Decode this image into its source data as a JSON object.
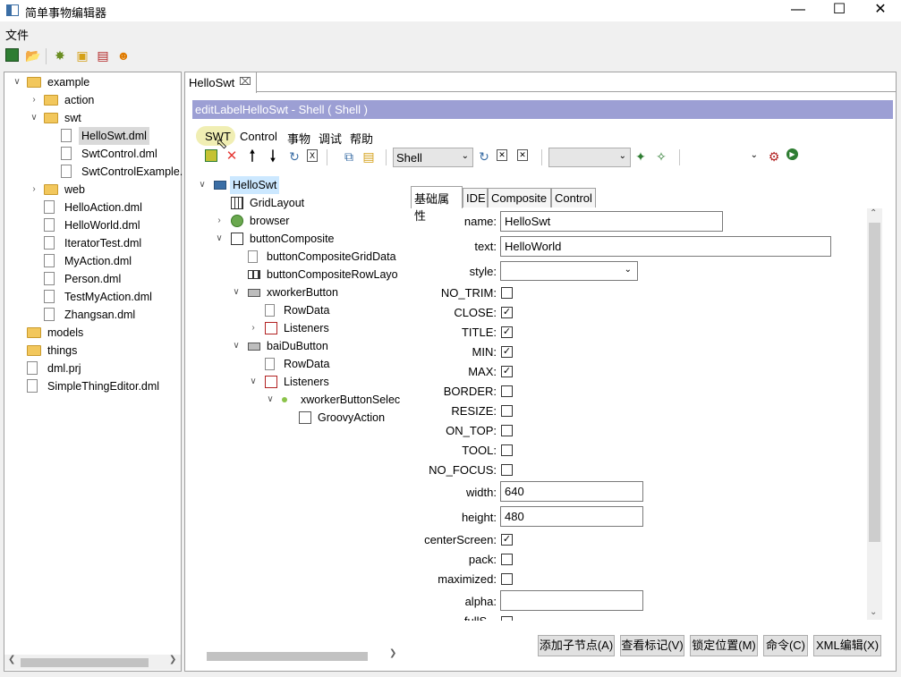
{
  "window": {
    "title": "简单事物编辑器"
  },
  "menu": {
    "file": "文件"
  },
  "tree": [
    {
      "label": "example",
      "depth": 0,
      "type": "folder",
      "expanded": true
    },
    {
      "label": "action",
      "depth": 1,
      "type": "folder",
      "expanded": false
    },
    {
      "label": "swt",
      "depth": 1,
      "type": "folder",
      "expanded": true
    },
    {
      "label": "HelloSwt.dml",
      "depth": 2,
      "type": "file",
      "selected": true
    },
    {
      "label": "SwtControl.dml",
      "depth": 2,
      "type": "file"
    },
    {
      "label": "SwtControlExample.",
      "depth": 2,
      "type": "file"
    },
    {
      "label": "web",
      "depth": 1,
      "type": "folder",
      "expanded": false
    },
    {
      "label": "HelloAction.dml",
      "depth": 1,
      "type": "file"
    },
    {
      "label": "HelloWorld.dml",
      "depth": 1,
      "type": "file"
    },
    {
      "label": "IteratorTest.dml",
      "depth": 1,
      "type": "file"
    },
    {
      "label": "MyAction.dml",
      "depth": 1,
      "type": "file"
    },
    {
      "label": "Person.dml",
      "depth": 1,
      "type": "file"
    },
    {
      "label": "TestMyAction.dml",
      "depth": 1,
      "type": "file"
    },
    {
      "label": "Zhangsan.dml",
      "depth": 1,
      "type": "file"
    },
    {
      "label": "models",
      "depth": 0,
      "type": "folder"
    },
    {
      "label": "things",
      "depth": 0,
      "type": "folder"
    },
    {
      "label": "dml.prj",
      "depth": 0,
      "type": "file"
    },
    {
      "label": "SimpleThingEditor.dml",
      "depth": 0,
      "type": "file"
    }
  ],
  "editor": {
    "tab_label": "HelloSwt",
    "header": "editLabelHelloSwt - Shell ( Shell )",
    "submenu": [
      "SWT",
      "Control",
      "事物",
      "调试",
      "帮助"
    ],
    "combo1": "Shell",
    "combo2": "",
    "combo3": ""
  },
  "struct_tree": [
    {
      "label": "HelloSwt",
      "depth": 0,
      "twisty": "v",
      "icon": "shell",
      "selected": true
    },
    {
      "label": "GridLayout",
      "depth": 1,
      "icon": "grid"
    },
    {
      "label": "browser",
      "depth": 1,
      "twisty": ">",
      "icon": "globe"
    },
    {
      "label": "buttonComposite",
      "depth": 1,
      "twisty": "v",
      "icon": "box"
    },
    {
      "label": "buttonCompositeGridData",
      "depth": 2,
      "icon": "file"
    },
    {
      "label": "buttonCompositeRowLayo",
      "depth": 2,
      "icon": "row"
    },
    {
      "label": "xworkerButton",
      "depth": 2,
      "twisty": "v",
      "icon": "button"
    },
    {
      "label": "RowData",
      "depth": 3,
      "icon": "file"
    },
    {
      "label": "Listeners",
      "depth": 3,
      "twisty": ">",
      "icon": "listener"
    },
    {
      "label": "baiDuButton",
      "depth": 2,
      "twisty": "v",
      "icon": "button"
    },
    {
      "label": "RowData",
      "depth": 3,
      "icon": "file"
    },
    {
      "label": "Listeners",
      "depth": 3,
      "twisty": "v",
      "icon": "listener"
    },
    {
      "label": "xworkerButtonSelec",
      "depth": 4,
      "twisty": "v",
      "icon": "dot"
    },
    {
      "label": "GroovyAction",
      "depth": 5,
      "icon": "groovy"
    }
  ],
  "prop_tabs": [
    "基础属性",
    "IDE",
    "Composite",
    "Control"
  ],
  "props": {
    "name_label": "name:",
    "name_value": "HelloSwt",
    "text_label": "text:",
    "text_value": "HelloWorld",
    "style_label": "style:",
    "style_value": "",
    "checks": [
      {
        "label": "NO_TRIM:",
        "checked": false
      },
      {
        "label": "CLOSE:",
        "checked": true
      },
      {
        "label": "TITLE:",
        "checked": true
      },
      {
        "label": "MIN:",
        "checked": true
      },
      {
        "label": "MAX:",
        "checked": true
      },
      {
        "label": "BORDER:",
        "checked": false
      },
      {
        "label": "RESIZE:",
        "checked": false
      },
      {
        "label": "ON_TOP:",
        "checked": false
      },
      {
        "label": "TOOL:",
        "checked": false
      },
      {
        "label": "NO_FOCUS:",
        "checked": false
      }
    ],
    "width_label": "width:",
    "width_value": "640",
    "height_label": "height:",
    "height_value": "480",
    "center_label": "centerScreen:",
    "center_checked": true,
    "pack_label": "pack:",
    "pack_checked": false,
    "max_label": "maximized:",
    "max_checked": false,
    "alpha_label": "alpha:",
    "alpha_value": "",
    "cut_label": "fullS..."
  },
  "buttons": {
    "add_child": "添加子节点(A)",
    "view_mark": "查看标记(V)",
    "lock_pos": "锁定位置(M)",
    "command": "命令(C)",
    "xml_edit": "XML编辑(X)"
  },
  "colors": {
    "header_bg": "#9c9fd4",
    "selection": "#cce8ff"
  }
}
